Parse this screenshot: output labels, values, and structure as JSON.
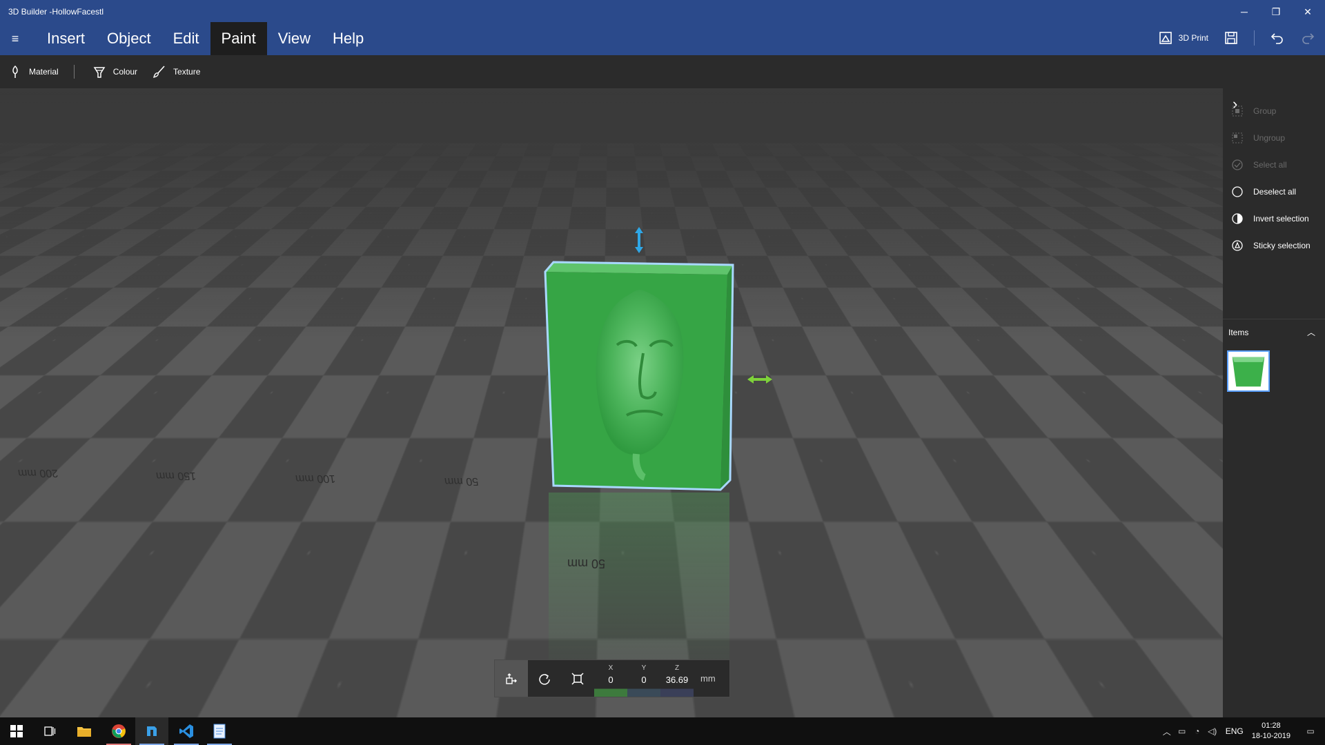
{
  "window": {
    "title": "3D Builder -HollowFacestl"
  },
  "window_controls": {
    "minimize": "─",
    "restore": "❐",
    "close": "✕"
  },
  "menu": {
    "items": [
      {
        "label": "Insert",
        "active": false
      },
      {
        "label": "Object",
        "active": false
      },
      {
        "label": "Edit",
        "active": false
      },
      {
        "label": "Paint",
        "active": true
      },
      {
        "label": "View",
        "active": false
      },
      {
        "label": "Help",
        "active": false
      }
    ]
  },
  "right_actions": {
    "print_label": "3D Print"
  },
  "toolbar": {
    "material": "Material",
    "colour": "Colour",
    "texture": "Texture"
  },
  "viewport": {
    "rulers": [
      "200 mm",
      "150 mm",
      "100 mm",
      "50 mm"
    ],
    "reflection_label": "50 mm",
    "model_color": "#3cb04a",
    "selection_color": "#9fd0ff"
  },
  "transform": {
    "x_label": "X",
    "x_value": "0",
    "y_label": "Y",
    "y_value": "0",
    "z_label": "Z",
    "z_value": "36.69",
    "unit": "mm"
  },
  "panel": {
    "items": [
      {
        "label": "Group",
        "enabled": false
      },
      {
        "label": "Ungroup",
        "enabled": false
      },
      {
        "label": "Select all",
        "enabled": false
      },
      {
        "label": "Deselect all",
        "enabled": true
      },
      {
        "label": "Invert selection",
        "enabled": true
      },
      {
        "label": "Sticky selection",
        "enabled": true
      }
    ],
    "items_header": "Items"
  },
  "taskbar": {
    "language": "ENG",
    "time": "01:28",
    "date": "18-10-2019"
  }
}
